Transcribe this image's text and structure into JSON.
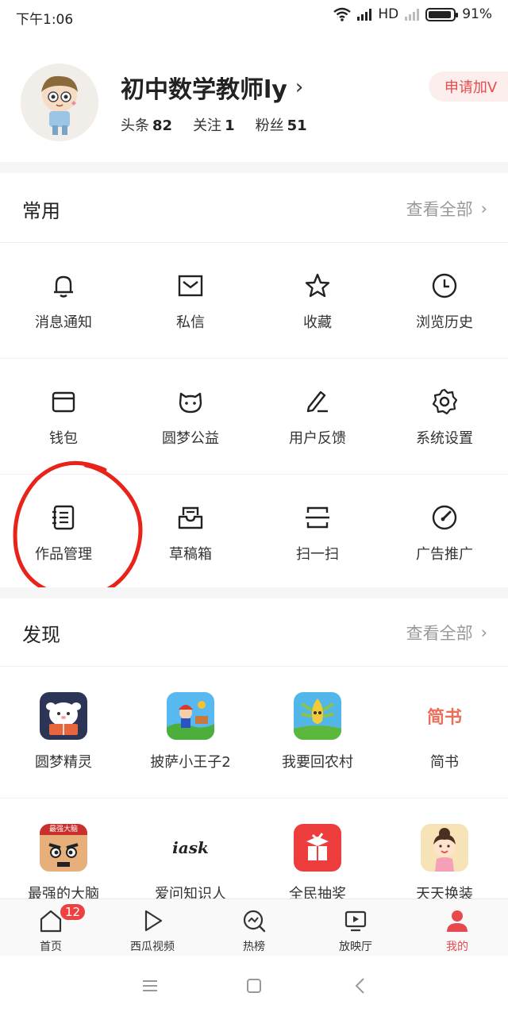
{
  "status_bar": {
    "time": "下午1:06",
    "network": "HD",
    "battery": "91%"
  },
  "profile": {
    "name": "初中数学教师ly",
    "stats": [
      {
        "label": "头条",
        "value": "82"
      },
      {
        "label": "关注",
        "value": "1"
      },
      {
        "label": "粉丝",
        "value": "51"
      }
    ],
    "apply_button": "申请加V"
  },
  "common": {
    "title": "常用",
    "more": "查看全部",
    "items": [
      {
        "label": "消息通知",
        "icon": "bell-icon"
      },
      {
        "label": "私信",
        "icon": "mail-icon"
      },
      {
        "label": "收藏",
        "icon": "star-icon"
      },
      {
        "label": "浏览历史",
        "icon": "clock-icon"
      },
      {
        "label": "钱包",
        "icon": "wallet-icon"
      },
      {
        "label": "圆梦公益",
        "icon": "cat-face-icon"
      },
      {
        "label": "用户反馈",
        "icon": "pen-icon"
      },
      {
        "label": "系统设置",
        "icon": "gear-icon"
      },
      {
        "label": "作品管理",
        "icon": "notebook-icon"
      },
      {
        "label": "草稿箱",
        "icon": "inbox-icon"
      },
      {
        "label": "扫一扫",
        "icon": "scan-icon"
      },
      {
        "label": "广告推广",
        "icon": "gauge-icon"
      }
    ]
  },
  "discover": {
    "title": "发现",
    "more": "查看全部",
    "apps": [
      {
        "label": "圆梦精灵",
        "icon": "dream-sprite-app-icon"
      },
      {
        "label": "披萨小王子2",
        "icon": "pizza-prince-app-icon"
      },
      {
        "label": "我要回农村",
        "icon": "farm-app-icon"
      },
      {
        "label": "简书",
        "icon": "jianshu-app-icon",
        "logo_text": "简书"
      },
      {
        "label": "最强的大脑",
        "icon": "brain-app-icon",
        "logo_text": "最强大脑"
      },
      {
        "label": "爱问知识人",
        "icon": "iask-app-icon",
        "logo_text": "iask"
      },
      {
        "label": "全民抽奖",
        "icon": "lottery-app-icon"
      },
      {
        "label": "天天换装",
        "icon": "dressup-app-icon"
      }
    ]
  },
  "bottom_nav": [
    {
      "label": "首页",
      "badge": "12"
    },
    {
      "label": "西瓜视频"
    },
    {
      "label": "热榜"
    },
    {
      "label": "放映厅"
    },
    {
      "label": "我的"
    }
  ],
  "colors": {
    "accent": "#e8494e",
    "annotation": "#e8231a"
  }
}
